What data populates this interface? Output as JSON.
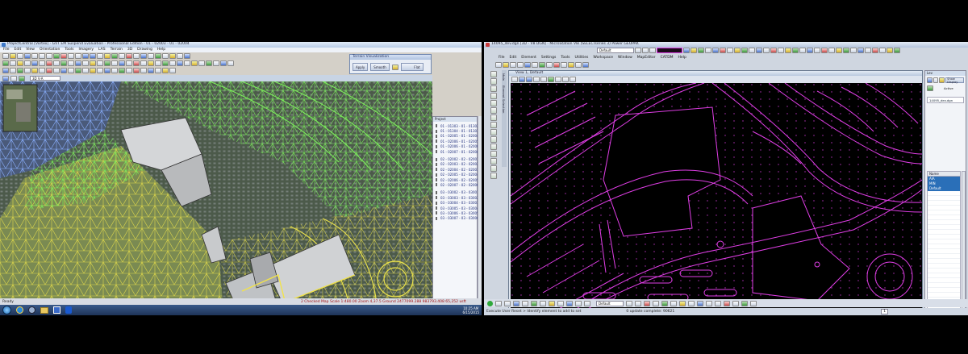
{
  "left": {
    "title": "ProjectCentral [Vortex] - GVT EM Suspend Evaluation - Professional Edition - 01 - 02003 - 01 - 02004",
    "menu": [
      "File",
      "Edit",
      "View",
      "Orientation",
      "Tools",
      "Imagery",
      "LAS",
      "Terrain",
      "3D",
      "Drawing",
      "Help"
    ],
    "layer_dropdown": "3D V-A",
    "terrain_dialog": {
      "title": "Terrain Visualization",
      "apply_label": "Apply",
      "smooth_label": "Smooth",
      "flat_label": "Flat"
    },
    "project_panel": {
      "header": "Project",
      "items": [
        "01 - 01303 - 01 - 01302",
        "01 - 01304 - 01 - 01303",
        "01 - 02005 - 01 - 02004",
        "01 - 02006 - 01 - 02005",
        "01 - 02006 - 01 - 02006",
        "01 - 02007 - 01 - 02008",
        "02 - 02002 - 02 - 02001",
        "02 - 02003 - 02 - 02002",
        "02 - 02004 - 02 - 02003",
        "02 - 02005 - 02 - 02004",
        "02 - 02006 - 02 - 02005",
        "02 - 02007 - 02 - 02006",
        "03 - 03002 - 03 - 03001",
        "03 - 03003 - 03 - 03002",
        "03 - 03004 - 03 - 03003",
        "03 - 03005 - 03 - 03004",
        "03 - 03006 - 03 - 03005",
        "03 - 03007 - 03 - 03006"
      ]
    },
    "statusbar": "2 Checked Map Scale 1:480.00 Zoom 4,37.5 Ground 2477099.288 983793.408 65,252 usft",
    "taskbar": {
      "status": "Ready",
      "time": "10:25 AM",
      "date": "6/15/2015"
    }
  },
  "right": {
    "title": "14095_dev.dgn [3D - V8 DGN] - MicroStation V8i (SELECTseries 3) Power GEOPAK",
    "menu": [
      "File",
      "Edit",
      "Element",
      "Settings",
      "Tools",
      "Utilities",
      "Workspace",
      "Window",
      "MapEditor",
      "CATDM",
      "Help"
    ],
    "level_dropdown": "Default",
    "view_title": "View 1, Default",
    "tab_labels": [
      "Main",
      "Element Selection"
    ],
    "level_panel": {
      "header": "Lev",
      "show_btn": "Show Display",
      "file": "14095_dev.dgn",
      "col_header": "Name",
      "selected": [
        "AIA",
        "MIN",
        "Default"
      ],
      "view_label": "Active"
    },
    "prompt": "Execute User Reset > Identify element to add to set",
    "status_msg": "0 update complete: 90621",
    "bottom_dropdown": "Default",
    "view_number": "1"
  },
  "colors": {
    "cad_background": "#000000",
    "cad_linework": "#e03ee6",
    "mesh_green": "#7cf25a",
    "mesh_yellow": "#f2e34a",
    "mesh_blue": "#6aa8ff",
    "selection": "#2a6fb8"
  },
  "icons": [
    "windows-start-icon",
    "internet-explorer-icon",
    "quicktime-icon",
    "folder-icon",
    "outlook-icon",
    "bluetooth-icon",
    "search-icon",
    "gear-icon"
  ]
}
